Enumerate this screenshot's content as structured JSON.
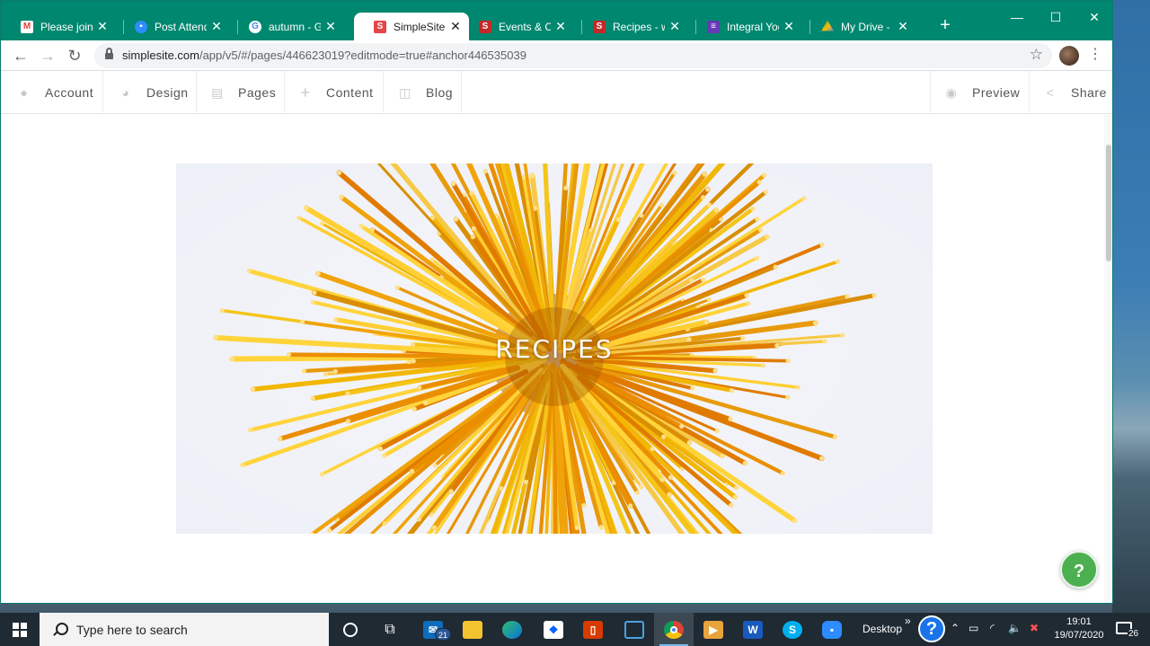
{
  "browser": {
    "tabs": [
      {
        "title": "Please join Zoom",
        "favicon": "gmail-icon",
        "color": "#ea4335"
      },
      {
        "title": "Post Attendee",
        "favicon": "zoom-icon",
        "color": "#2d8cff"
      },
      {
        "title": "autumn - Google",
        "favicon": "google-icon",
        "color": "#ffffff"
      },
      {
        "title": "SimpleSite",
        "favicon": "simplesite-icon",
        "color": "#e2454a"
      },
      {
        "title": "Events & Classes",
        "favicon": "simplesite-icon",
        "color": "#c62828"
      },
      {
        "title": "Recipes - www",
        "favicon": "simplesite-icon",
        "color": "#c62828"
      },
      {
        "title": "Integral Yoga",
        "favicon": "forms-icon",
        "color": "#673ab7"
      },
      {
        "title": "My Drive - Google",
        "favicon": "drive-icon",
        "color": "#fbbc04"
      }
    ],
    "active_tab": 3,
    "url_host": "simplesite.com",
    "url_rest": "/app/v5/#/pages/446623019?editmode=true#anchor446535039"
  },
  "editor": {
    "left_items": [
      {
        "label": "Account",
        "icon": "person-icon"
      },
      {
        "label": "Design",
        "icon": "palette-icon"
      },
      {
        "label": "Pages",
        "icon": "page-icon"
      },
      {
        "label": "Content",
        "icon": "plus-icon"
      },
      {
        "label": "Blog",
        "icon": "blog-icon"
      }
    ],
    "right_items": [
      {
        "label": "Preview",
        "icon": "eye-icon"
      },
      {
        "label": "Share",
        "icon": "share-icon"
      }
    ]
  },
  "page": {
    "hero_title": "RECIPES",
    "help_label": "?"
  },
  "taskbar": {
    "search_placeholder": "Type here to search",
    "mail_badge": "21",
    "desktop_label": "Desktop",
    "time": "19:01",
    "date": "19/07/2020",
    "notification_count": "26"
  }
}
